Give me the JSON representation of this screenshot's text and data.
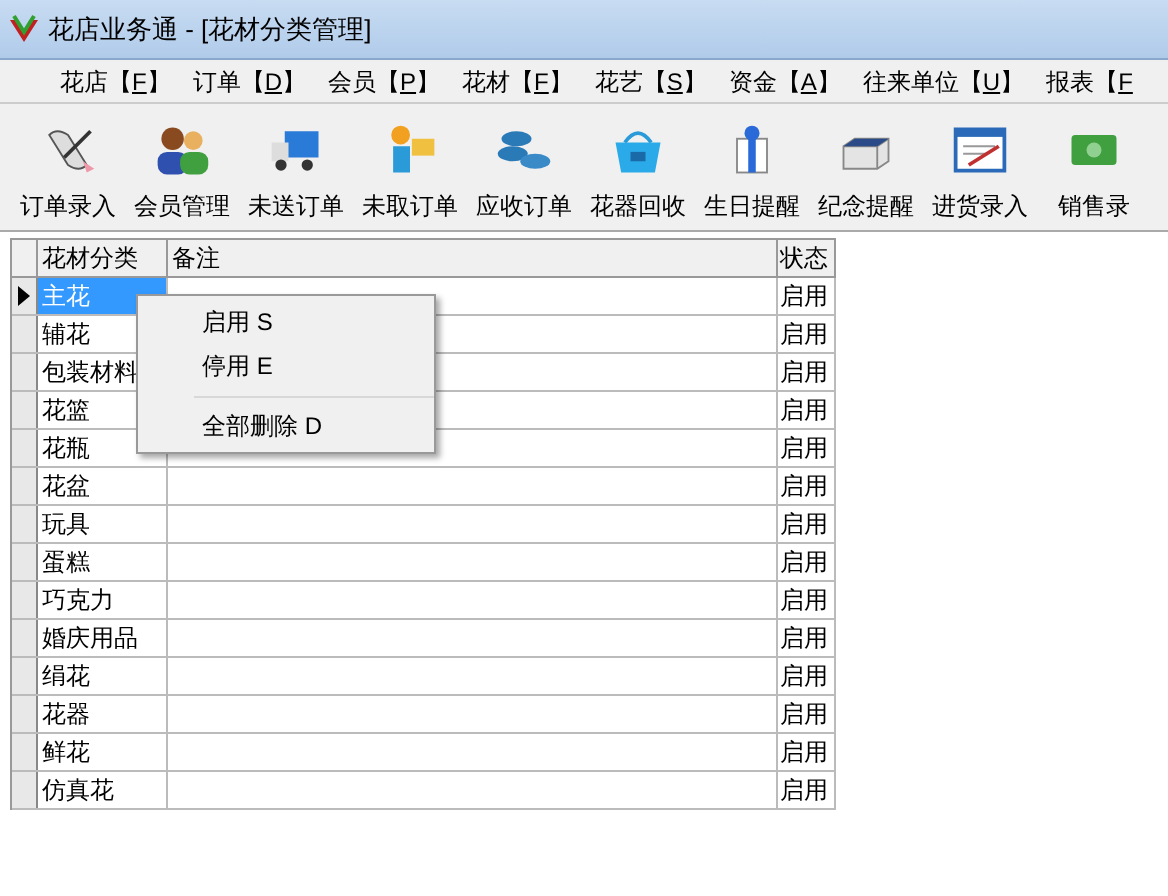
{
  "window": {
    "title": "花店业务通 - [花材分类管理]"
  },
  "menu": [
    {
      "label": "花店【",
      "hotkey": "F",
      "suffix": "】"
    },
    {
      "label": "订单【",
      "hotkey": "D",
      "suffix": "】"
    },
    {
      "label": "会员【",
      "hotkey": "P",
      "suffix": "】"
    },
    {
      "label": "花材【",
      "hotkey": "F",
      "suffix": "】"
    },
    {
      "label": "花艺【",
      "hotkey": "S",
      "suffix": "】"
    },
    {
      "label": "资金【",
      "hotkey": "A",
      "suffix": "】"
    },
    {
      "label": "往来单位【",
      "hotkey": "U",
      "suffix": "】"
    },
    {
      "label": "报表【",
      "hotkey": "F"
    }
  ],
  "toolbar": [
    {
      "label": "订单录入"
    },
    {
      "label": "会员管理"
    },
    {
      "label": "未送订单"
    },
    {
      "label": "未取订单"
    },
    {
      "label": "应收订单"
    },
    {
      "label": "花器回收"
    },
    {
      "label": "生日提醒"
    },
    {
      "label": "纪念提醒"
    },
    {
      "label": "进货录入"
    },
    {
      "label": "销售录"
    }
  ],
  "table": {
    "columns": [
      "花材分类",
      "备注",
      "状态"
    ],
    "rows": [
      {
        "category": "主花",
        "status": "启用",
        "selected": true
      },
      {
        "category": "辅花",
        "status": "启用",
        "selected": false
      },
      {
        "category": "包装材料",
        "status": "启用",
        "selected": false
      },
      {
        "category": "花篮",
        "status": "启用",
        "selected": false
      },
      {
        "category": "花瓶",
        "status": "启用",
        "selected": false
      },
      {
        "category": "花盆",
        "status": "启用",
        "selected": false
      },
      {
        "category": "玩具",
        "status": "启用",
        "selected": false
      },
      {
        "category": "蛋糕",
        "status": "启用",
        "selected": false
      },
      {
        "category": "巧克力",
        "status": "启用",
        "selected": false
      },
      {
        "category": "婚庆用品",
        "status": "启用",
        "selected": false
      },
      {
        "category": "绢花",
        "status": "启用",
        "selected": false
      },
      {
        "category": "花器",
        "status": "启用",
        "selected": false
      },
      {
        "category": "鲜花",
        "status": "启用",
        "selected": false
      },
      {
        "category": "仿真花",
        "status": "启用",
        "selected": false
      }
    ]
  },
  "context_menu": {
    "groups": [
      [
        "启用 S",
        "停用 E"
      ],
      [
        "全部删除 D"
      ]
    ]
  }
}
